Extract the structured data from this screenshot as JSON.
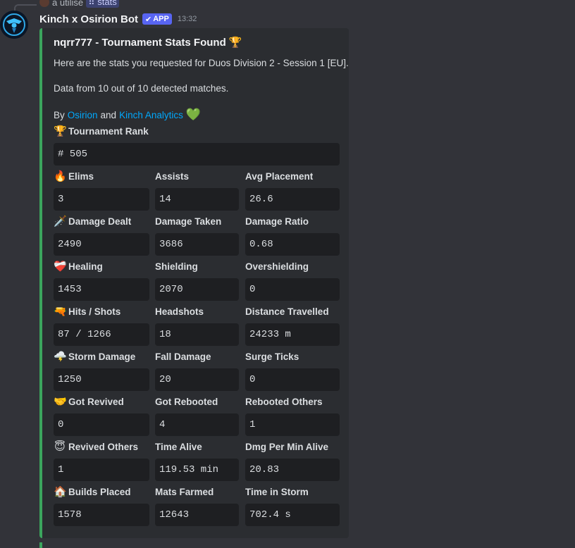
{
  "reply": {
    "text": "a utilisé",
    "command": "stats"
  },
  "message": {
    "bot_name": "Kinch x Osirion Bot",
    "app_tag": "APP",
    "timestamp": "13:32"
  },
  "embed": {
    "title": "nqrr777 - Tournament Stats Found",
    "title_emoji": "🏆",
    "line1": "Here are the stats you requested for Duos Division 2 - Session 1 [EU].",
    "line2": "Data from 10 out of 10 detected matches.",
    "by_prefix": "By",
    "link1": "Osirion",
    "and": "and",
    "link2": "Kinch Analytics",
    "heart_emoji": "💚",
    "accent_color": "#3ba55d",
    "rank": {
      "emoji": "🏆",
      "name": "Tournament Rank",
      "value": "# 505"
    },
    "rows": [
      {
        "emoji": "🔥",
        "fields": [
          {
            "name": "Elims",
            "value": "3"
          },
          {
            "name": "Assists",
            "value": "14"
          },
          {
            "name": "Avg Placement",
            "value": "26.6"
          }
        ]
      },
      {
        "emoji": "🗡️",
        "fields": [
          {
            "name": "Damage Dealt",
            "value": "2490"
          },
          {
            "name": "Damage Taken",
            "value": "3686"
          },
          {
            "name": "Damage Ratio",
            "value": "0.68"
          }
        ]
      },
      {
        "emoji": "❤️‍🩹",
        "fields": [
          {
            "name": "Healing",
            "value": "1453"
          },
          {
            "name": "Shielding",
            "value": "2070"
          },
          {
            "name": "Overshielding",
            "value": "0"
          }
        ]
      },
      {
        "emoji": "🔫",
        "fields": [
          {
            "name": "Hits / Shots",
            "value": "87 / 1266"
          },
          {
            "name": "Headshots",
            "value": "18"
          },
          {
            "name": "Distance Travelled",
            "value": "24233 m"
          }
        ]
      },
      {
        "emoji": "🌩️",
        "fields": [
          {
            "name": "Storm Damage",
            "value": "1250"
          },
          {
            "name": "Fall Damage",
            "value": "20"
          },
          {
            "name": "Surge Ticks",
            "value": "0"
          }
        ]
      },
      {
        "emoji": "🤝",
        "fields": [
          {
            "name": "Got Revived",
            "value": "0"
          },
          {
            "name": "Got Rebooted",
            "value": "4"
          },
          {
            "name": "Rebooted Others",
            "value": "1"
          }
        ]
      },
      {
        "emoji": "😇",
        "fields": [
          {
            "name": "Revived Others",
            "value": "1"
          },
          {
            "name": "Time Alive",
            "value": "119.53 min"
          },
          {
            "name": "Dmg Per Min Alive",
            "value": "20.83"
          }
        ]
      },
      {
        "emoji": "🏠",
        "fields": [
          {
            "name": "Builds Placed",
            "value": "1578"
          },
          {
            "name": "Mats Farmed",
            "value": "12643"
          },
          {
            "name": "Time in Storm",
            "value": "702.4 s"
          }
        ]
      }
    ]
  }
}
